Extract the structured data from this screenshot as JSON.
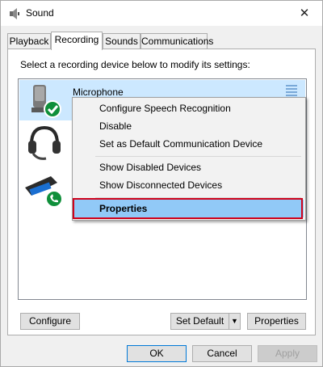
{
  "window": {
    "title": "Sound",
    "close_symbol": "✕"
  },
  "tabs": [
    {
      "label": "Playback",
      "active": false
    },
    {
      "label": "Recording",
      "active": true
    },
    {
      "label": "Sounds",
      "active": false
    },
    {
      "label": "Communications",
      "active": false
    }
  ],
  "instruction": "Select a recording device below to modify its settings:",
  "devices": [
    {
      "label": "Microphone",
      "icon": "microphone-icon",
      "status": "default-check",
      "selected": true
    },
    {
      "label": "",
      "icon": "headset-icon",
      "status": "none"
    },
    {
      "label": "",
      "icon": "speakerphone-icon",
      "status": "default-communication-phone"
    }
  ],
  "context_menu": {
    "items": [
      {
        "label": "Configure Speech Recognition"
      },
      {
        "label": "Disable"
      },
      {
        "label": "Set as Default Communication Device"
      },
      {
        "label": "Show Disabled Devices"
      },
      {
        "label": "Show Disconnected Devices"
      },
      {
        "label": "Properties",
        "highlighted": true
      }
    ]
  },
  "buttons": {
    "configure": "Configure",
    "set_default": "Set Default",
    "set_default_arrow": "▼",
    "properties": "Properties",
    "ok": "OK",
    "cancel": "Cancel",
    "apply": "Apply"
  },
  "colors": {
    "selection": "#cce8ff",
    "menu_highlight": "#91c9f7",
    "annotation_red": "#d0021b",
    "check_green": "#0f8f3a"
  }
}
